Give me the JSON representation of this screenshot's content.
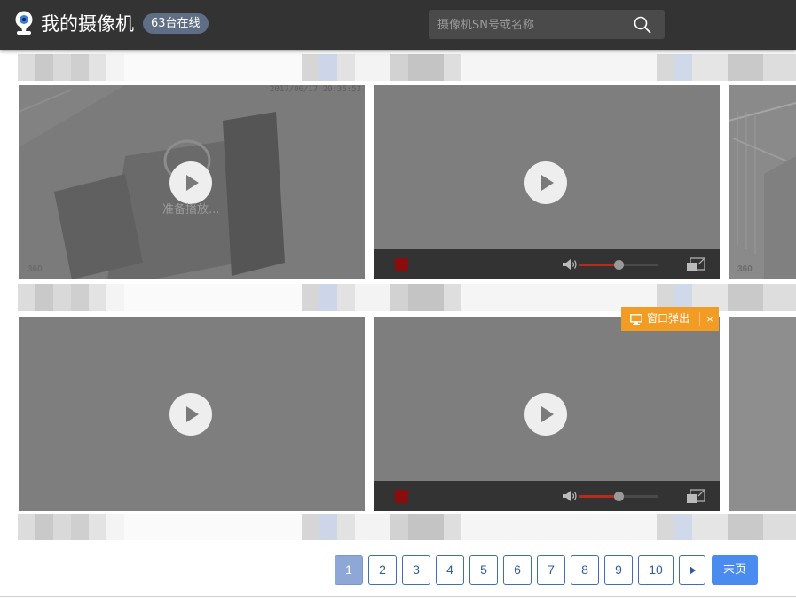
{
  "header": {
    "title": "我的摄像机",
    "online_badge": "63台在线",
    "search": {
      "placeholder": "摄像机SN号或名称"
    }
  },
  "tiles": [
    {
      "timestamp": "2017/06/17 20:35:53",
      "watermark": "360",
      "status": "准备播放...",
      "state": "preparing"
    },
    {
      "state": "paused-with-controls",
      "volume_percent": 50
    },
    {
      "state": "partial",
      "watermark": "360"
    },
    {
      "state": "idle"
    },
    {
      "state": "paused-with-controls",
      "volume_percent": 50
    },
    {
      "state": "partial"
    }
  ],
  "popout": {
    "label": "窗口弹出",
    "close": "×",
    "icon": "monitor-icon"
  },
  "pagination": {
    "pages": [
      "1",
      "2",
      "3",
      "4",
      "5",
      "6",
      "7",
      "8",
      "9",
      "10"
    ],
    "current": "1",
    "last_label": "末页"
  },
  "colors": {
    "header_bg": "#333333",
    "badge_bg": "#5f6e84",
    "popout_bg": "#f39c23",
    "page_active": "#8ea7d6",
    "page_last": "#4a8bf0",
    "record": "#8a0c0c",
    "volume_fill": "#b52b1f"
  }
}
